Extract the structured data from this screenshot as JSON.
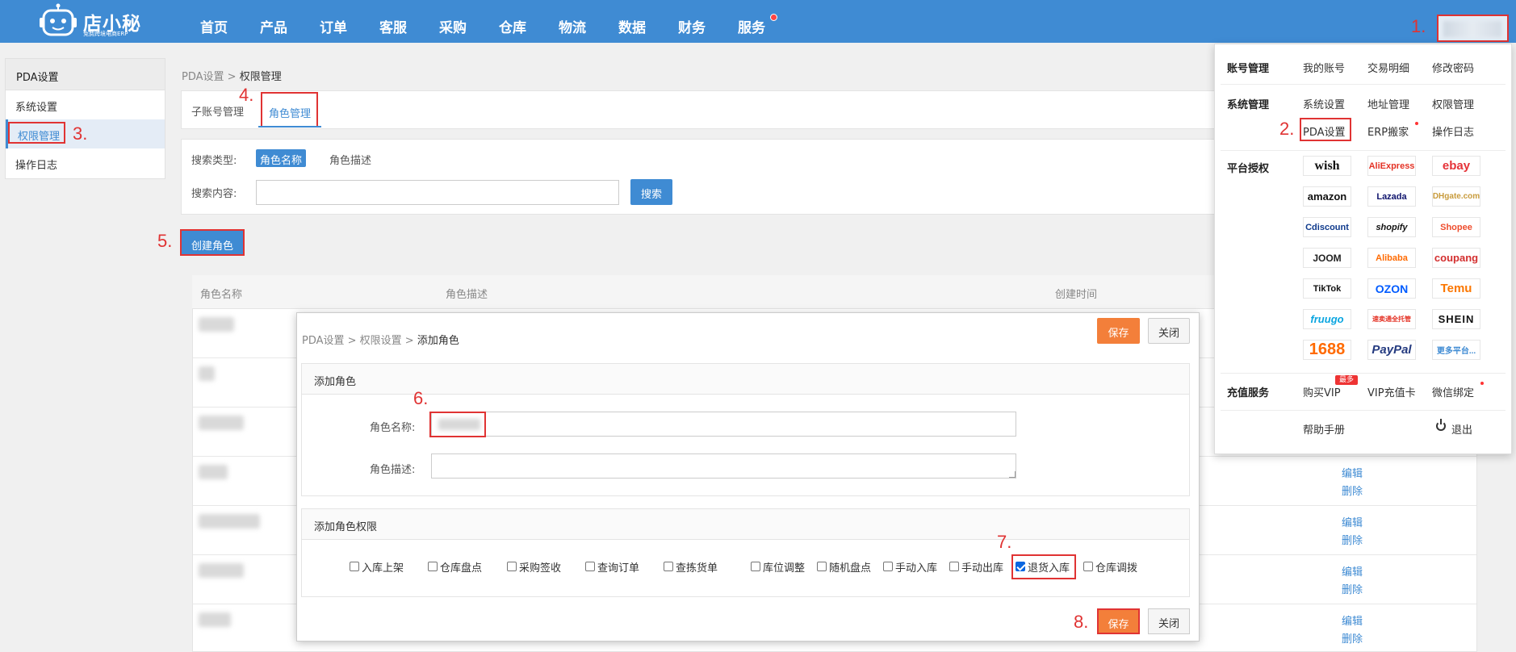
{
  "header": {
    "logo_text": "店小秘",
    "logo_sub": "免费跨境电商ERP",
    "nav": [
      "首页",
      "产品",
      "订单",
      "客服",
      "采购",
      "仓库",
      "物流",
      "数据",
      "财务",
      "服务"
    ]
  },
  "annotations": [
    "1.",
    "2.",
    "3.",
    "4.",
    "5.",
    "6.",
    "7.",
    "8."
  ],
  "sidebar": {
    "title": "PDA设置",
    "items": [
      "系统设置",
      "权限管理",
      "操作日志"
    ],
    "active": "权限管理"
  },
  "breadcrumb": {
    "parent": "PDA设置",
    "sep": " > ",
    "current": "权限管理"
  },
  "tabs": [
    "子账号管理",
    "角色管理"
  ],
  "search": {
    "type_label": "搜索类型:",
    "type_options": [
      "角色名称",
      "角色描述"
    ],
    "content_label": "搜索内容:",
    "content_value": "",
    "button": "搜索"
  },
  "create_button": "创建角色",
  "table": {
    "headers": [
      "角色名称",
      "角色描述",
      "创建时间"
    ],
    "actions": [
      "编辑",
      "删除"
    ]
  },
  "modal": {
    "breadcrumb": "PDA设置 > 权限设置 > ",
    "breadcrumb_current": "添加角色",
    "save": "保存",
    "close": "关闭",
    "section1_title": "添加角色",
    "role_name_label": "角色名称:",
    "role_desc_label": "角色描述:",
    "section2_title": "添加角色权限",
    "permissions": [
      {
        "label": "入库上架",
        "checked": false
      },
      {
        "label": "仓库盘点",
        "checked": false
      },
      {
        "label": "采购签收",
        "checked": false
      },
      {
        "label": "查询订单",
        "checked": false
      },
      {
        "label": "查拣货单",
        "checked": false
      },
      {
        "label": "库位调整",
        "checked": false
      },
      {
        "label": "随机盘点",
        "checked": false
      },
      {
        "label": "手动入库",
        "checked": false
      },
      {
        "label": "手动出库",
        "checked": false
      },
      {
        "label": "退货入库",
        "checked": true
      },
      {
        "label": "仓库调拨",
        "checked": false
      }
    ]
  },
  "dropdown": {
    "account": {
      "title": "账号管理",
      "items": [
        "我的账号",
        "交易明细",
        "修改密码"
      ]
    },
    "system": {
      "title": "系统管理",
      "items": [
        "系统设置",
        "地址管理",
        "权限管理",
        "PDA设置",
        "ERP搬家",
        "操作日志"
      ]
    },
    "platform": {
      "title": "平台授权",
      "logos": [
        "wish",
        "AliExpress",
        "ebay",
        "amazon",
        "Lazada",
        "DHgate.com",
        "Cdiscount",
        "shopify",
        "Shopee",
        "JOOM",
        "Alibaba",
        "coupang",
        "TikTok",
        "OZON",
        "Temu",
        "fruugo",
        "速卖通全托管",
        "SHEIN",
        "1688",
        "PayPal",
        "更多平台..."
      ]
    },
    "recharge": {
      "title": "充值服务",
      "items": [
        "购买VIP",
        "VIP充值卡",
        "微信绑定"
      ],
      "hot_badge": "最多"
    },
    "footer": {
      "help": "帮助手册",
      "logout": "退出"
    }
  },
  "colors": {
    "primary": "#3f8bd3",
    "orange": "#f37f3a",
    "annotation": "#e03333"
  }
}
